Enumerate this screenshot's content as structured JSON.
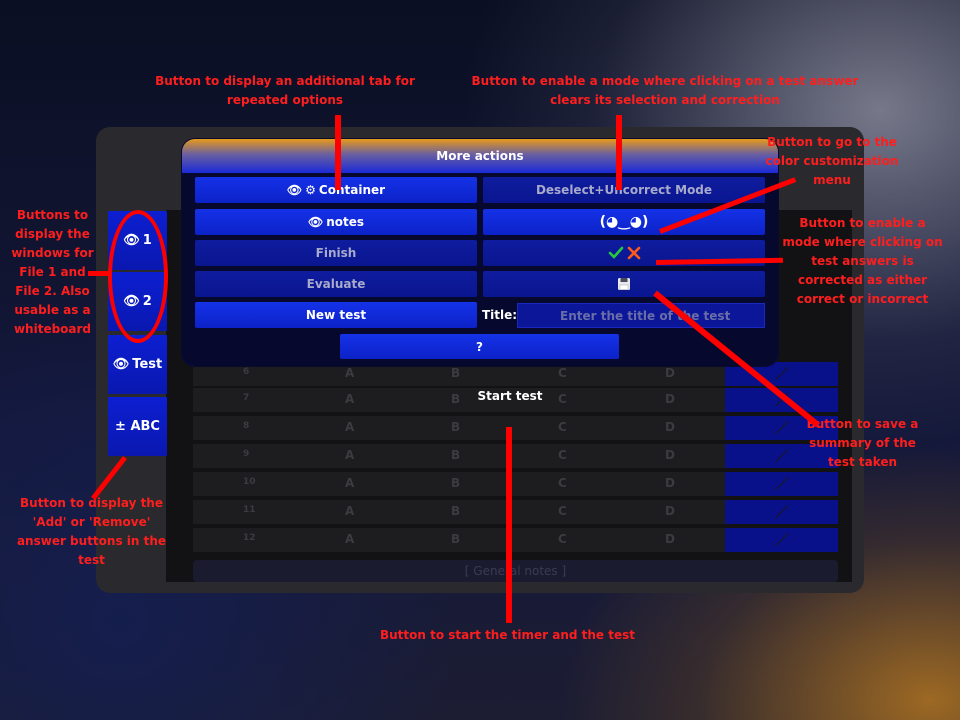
{
  "side_buttons": [
    {
      "icon": "eye-icon",
      "label": "1"
    },
    {
      "icon": "eye-icon",
      "label": "2"
    },
    {
      "icon": "eye-icon",
      "label": "Test"
    },
    {
      "icon": "",
      "label": "± ABC"
    }
  ],
  "test_rows": [
    {
      "num": "6",
      "options": [
        "A",
        "B",
        "C",
        "D"
      ]
    },
    {
      "num": "7",
      "options": [
        "A",
        "B",
        "C",
        "D"
      ]
    },
    {
      "num": "8",
      "options": [
        "A",
        "B",
        "C",
        "D"
      ]
    },
    {
      "num": "9",
      "options": [
        "A",
        "B",
        "C",
        "D"
      ]
    },
    {
      "num": "10",
      "options": [
        "A",
        "B",
        "C",
        "D"
      ]
    },
    {
      "num": "11",
      "options": [
        "A",
        "B",
        "C",
        "D"
      ]
    },
    {
      "num": "12",
      "options": [
        "A",
        "B",
        "C",
        "D"
      ]
    }
  ],
  "general_notes": "[ General notes ]",
  "start_test": "Start test",
  "modal": {
    "title": "More actions",
    "container_label": "Container",
    "deselect_label": "Deselect+Uncorrect Mode",
    "notes_label": "notes",
    "kaomoji_label": "(◕‿◕)",
    "finish_label": "Finish",
    "evaluate_label": "Evaluate",
    "new_test_label": "New test",
    "title_label": "Title:",
    "title_placeholder": "Enter the title of the test",
    "help_label": "?"
  },
  "annotations": {
    "repeated_options": "Button to display an additional tab for repeated options",
    "deselect_mode": "Button to enable a mode where clicking on a test answer clears its selection and correction",
    "color_menu": "Button to go to the color customization menu",
    "correct_mode": "Button to enable a mode where clicking on test answers is corrected as either correct or incorrect",
    "files": "Buttons to display the windows for File 1 and File 2. Also usable as a whiteboard",
    "save_summary": "Button to save a summary of the test taken",
    "add_remove": "Button to display the 'Add' or 'Remove' answer buttons in the test",
    "start_timer": "Button to start the timer and the test"
  },
  "colors": {
    "accent_blue": "#0c1fd1",
    "header_orange": "#e69a1a",
    "annotation_red": "#ff1e1e",
    "check_green": "#27c93f",
    "cross_orange": "#ff5a1a"
  }
}
